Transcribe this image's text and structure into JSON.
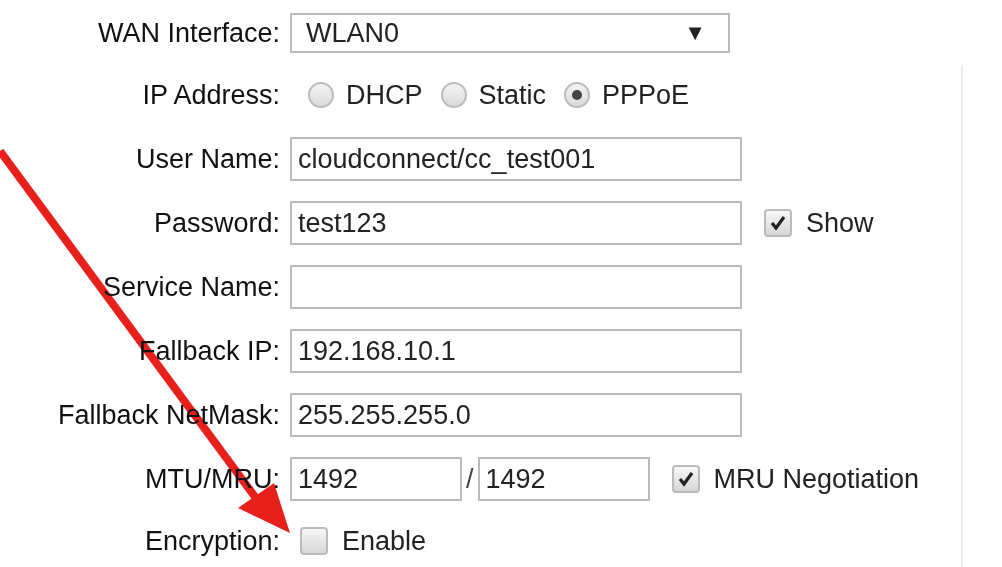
{
  "wan_interface": {
    "label": "WAN Interface:",
    "value": "WLAN0",
    "caret": "▼"
  },
  "ip_address": {
    "label": "IP Address:",
    "options": [
      {
        "label": "DHCP",
        "selected": false
      },
      {
        "label": "Static",
        "selected": false
      },
      {
        "label": "PPPoE",
        "selected": true
      }
    ]
  },
  "user_name": {
    "label": "User Name:",
    "value": "cloudconnect/cc_test001"
  },
  "password": {
    "label": "Password:",
    "value": "test123",
    "show": {
      "label": "Show",
      "checked": true
    }
  },
  "service_name": {
    "label": "Service Name:"
  },
  "fallback_ip": {
    "label": "Fallback IP:",
    "value": "192.168.10.1"
  },
  "fallback_netmask": {
    "label": "Fallback NetMask:",
    "value": "255.255.255.0"
  },
  "mtu_mru": {
    "label": "MTU/MRU:",
    "mtu": "1492",
    "separator": "/",
    "mru": "1492",
    "negotiation": {
      "label": "MRU Negotiation",
      "checked": true
    }
  },
  "encryption": {
    "label": "Encryption:",
    "enable": {
      "label": "Enable",
      "checked": false
    }
  }
}
